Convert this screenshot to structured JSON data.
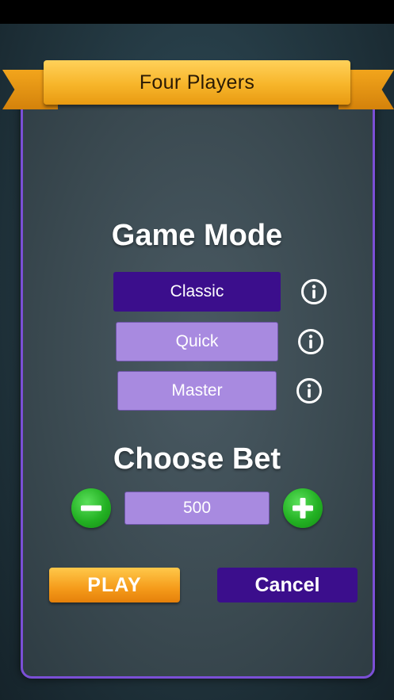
{
  "dialog": {
    "title": "Four Players"
  },
  "game_mode": {
    "heading": "Game Mode",
    "options": [
      {
        "label": "Classic",
        "selected": true,
        "info_icon": "info-icon"
      },
      {
        "label": "Quick",
        "selected": false,
        "info_icon": "info-icon"
      },
      {
        "label": "Master",
        "selected": false,
        "info_icon": "info-icon"
      }
    ]
  },
  "bet": {
    "heading": "Choose Bet",
    "value": "500",
    "decrease_icon": "minus-icon",
    "increase_icon": "plus-icon"
  },
  "actions": {
    "play_label": "PLAY",
    "cancel_label": "Cancel"
  },
  "colors": {
    "ribbon": "#f7b52a",
    "panel_border": "#7b4fd6",
    "selected_mode": "#3b0e8c",
    "unselected_mode": "#a88ae0",
    "bet_buttons": "#23b123",
    "play_button": "#f59b1a",
    "cancel_button": "#3b0e8c"
  }
}
